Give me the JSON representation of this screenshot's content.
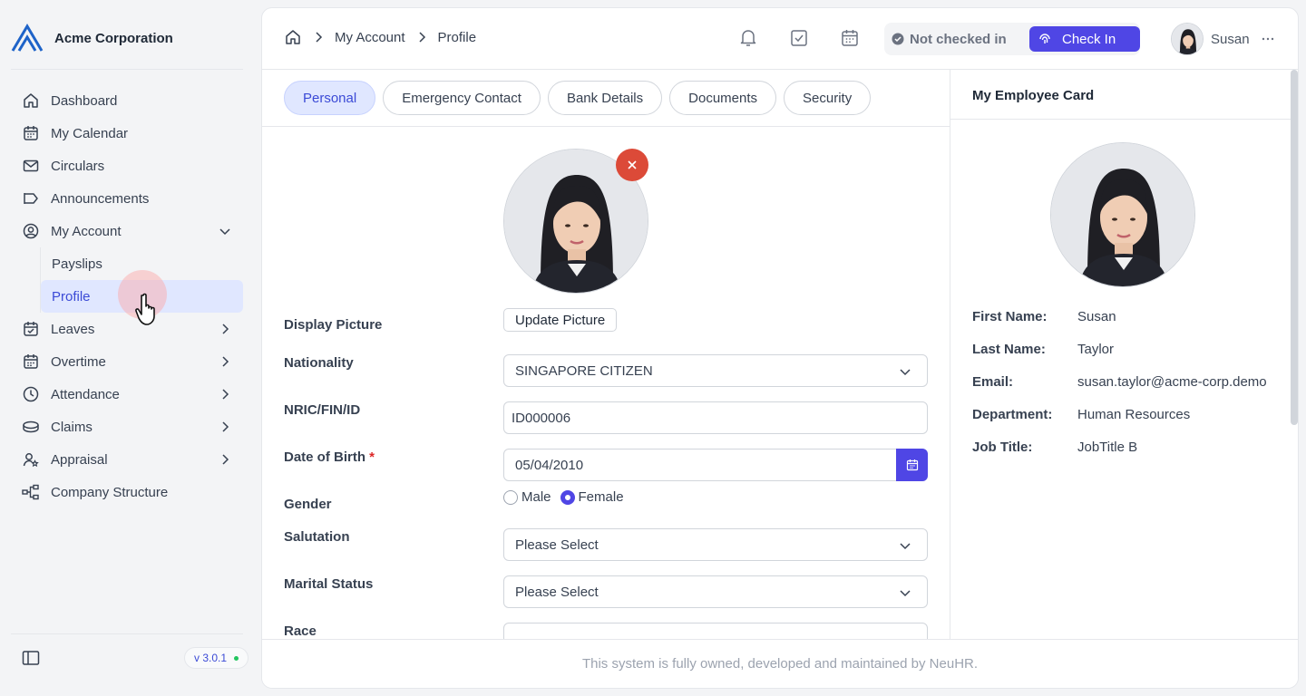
{
  "brand": {
    "name": "Acme Corporation"
  },
  "sidebar": {
    "items": [
      {
        "label": "Dashboard",
        "icon": "home-icon"
      },
      {
        "label": "My Calendar",
        "icon": "calendar-icon"
      },
      {
        "label": "Circulars",
        "icon": "mail-icon"
      },
      {
        "label": "Announcements",
        "icon": "megaphone-icon"
      },
      {
        "label": "My Account",
        "icon": "user-circle-icon",
        "expanded": true,
        "children": [
          {
            "label": "Payslips"
          },
          {
            "label": "Profile",
            "active": true
          }
        ]
      },
      {
        "label": "Leaves",
        "icon": "calendar-check-icon"
      },
      {
        "label": "Overtime",
        "icon": "calendar-clock-icon"
      },
      {
        "label": "Attendance",
        "icon": "clock-icon"
      },
      {
        "label": "Claims",
        "icon": "coins-icon"
      },
      {
        "label": "Appraisal",
        "icon": "user-star-icon"
      },
      {
        "label": "Company Structure",
        "icon": "org-chart-icon"
      }
    ],
    "version": "v 3.0.1"
  },
  "breadcrumb": {
    "level1": "My Account",
    "level2": "Profile"
  },
  "header": {
    "status": "Not checked in",
    "check_in": "Check In",
    "user_name": "Susan"
  },
  "tabs": [
    {
      "label": "Personal",
      "active": true
    },
    {
      "label": "Emergency Contact"
    },
    {
      "label": "Bank Details"
    },
    {
      "label": "Documents"
    },
    {
      "label": "Security"
    }
  ],
  "form": {
    "display_picture_label": "Display Picture",
    "update_picture": "Update Picture",
    "nationality_label": "Nationality",
    "nationality_value": "SINGAPORE CITIZEN",
    "nric_label": "NRIC/FIN/ID",
    "nric_value": "ID000006",
    "dob_label": "Date of Birth",
    "dob_required": "*",
    "dob_value": "05/04/2010",
    "gender_label": "Gender",
    "gender_options": [
      "Male",
      "Female"
    ],
    "gender_selected": "Female",
    "salutation_label": "Salutation",
    "salutation_value": "Please Select",
    "marital_label": "Marital Status",
    "marital_value": "Please Select",
    "race_label": "Race",
    "race_value": ""
  },
  "employee_card": {
    "title": "My Employee Card",
    "first_name_key": "First Name:",
    "first_name": "Susan",
    "last_name_key": "Last Name:",
    "last_name": "Taylor",
    "email_key": "Email:",
    "email": "susan.taylor@acme-corp.demo",
    "department_key": "Department:",
    "department": "Human Resources",
    "job_title_key": "Job Title:",
    "job_title": "JobTitle B"
  },
  "footer": {
    "text": "This system is fully owned, developed and maintained by NeuHR."
  },
  "colors": {
    "accent": "#4f46e5",
    "accent_soft": "#e0e7ff",
    "danger": "#dc4a38"
  }
}
